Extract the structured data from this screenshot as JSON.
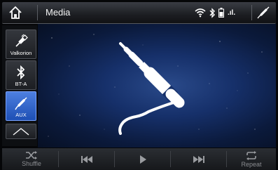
{
  "header": {
    "title": "Media",
    "signal_text": ".ıl."
  },
  "sidebar": {
    "items": [
      {
        "label": "Valkorion",
        "icon": "usb-icon",
        "active": false
      },
      {
        "label": "BT-A",
        "icon": "bluetooth-icon",
        "active": false
      },
      {
        "label": "AUX",
        "icon": "aux-cable-icon",
        "active": true
      }
    ],
    "scroll_icon": "chevron-up-icon"
  },
  "main": {
    "artwork_icon": "aux-jack-icon"
  },
  "controls": {
    "shuffle_label": "Shuffle",
    "repeat_label": "Repeat"
  },
  "colors": {
    "active_source": "#2f64d0",
    "background_blue": "#16306a"
  }
}
